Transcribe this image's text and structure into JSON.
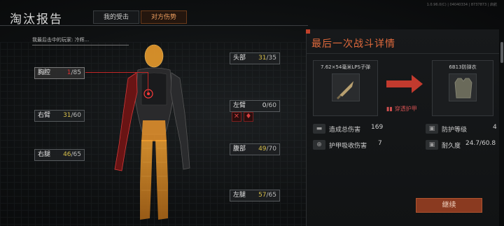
{
  "header": {
    "title": "淘汰报告",
    "tabs": [
      {
        "label": "我的受击",
        "active": false
      },
      {
        "label": "对方伤势",
        "active": true
      }
    ],
    "version": "1.0.96.0(C)  |  04040334  |  8737873  |  启航"
  },
  "kill_note": "我最后击中的玩家: 冷辉...",
  "body_parts": {
    "chest": {
      "label": "胸腔",
      "current": "1",
      "max": "/85"
    },
    "head": {
      "label": "头部",
      "current": "31",
      "max": "/35"
    },
    "right_arm": {
      "label": "右臂",
      "current": "31",
      "max": "/60"
    },
    "left_arm": {
      "label": "左臂",
      "current": "0",
      "max": "/60"
    },
    "stomach": {
      "label": "腹部",
      "current": "49",
      "max": "/70"
    },
    "right_leg": {
      "label": "右腿",
      "current": "46",
      "max": "/65"
    },
    "left_leg": {
      "label": "左腿",
      "current": "57",
      "max": "/65"
    }
  },
  "status_icons": [
    "fracture-icon",
    "bleeding-icon"
  ],
  "battle": {
    "title": "最后一次战斗详情",
    "ammo_name": "7.62×54毫米LPS子弹",
    "armor_name": "6B13防弹衣",
    "penetrate_text": "穿透护甲",
    "stats": {
      "total_damage_label": "造成总伤害",
      "total_damage_value": "169",
      "armor_absorb_label": "护甲吸收伤害",
      "armor_absorb_value": "7",
      "protection_class_label": "防护等级",
      "protection_class_value": "4",
      "durability_label": "耐久度",
      "durability_value": "24.7/60.8"
    },
    "continue_label": "继续"
  },
  "colors": {
    "accent": "#e06a3c",
    "critical": "#e33131",
    "hp": "#d6be4a",
    "button": "#8a3a20"
  }
}
